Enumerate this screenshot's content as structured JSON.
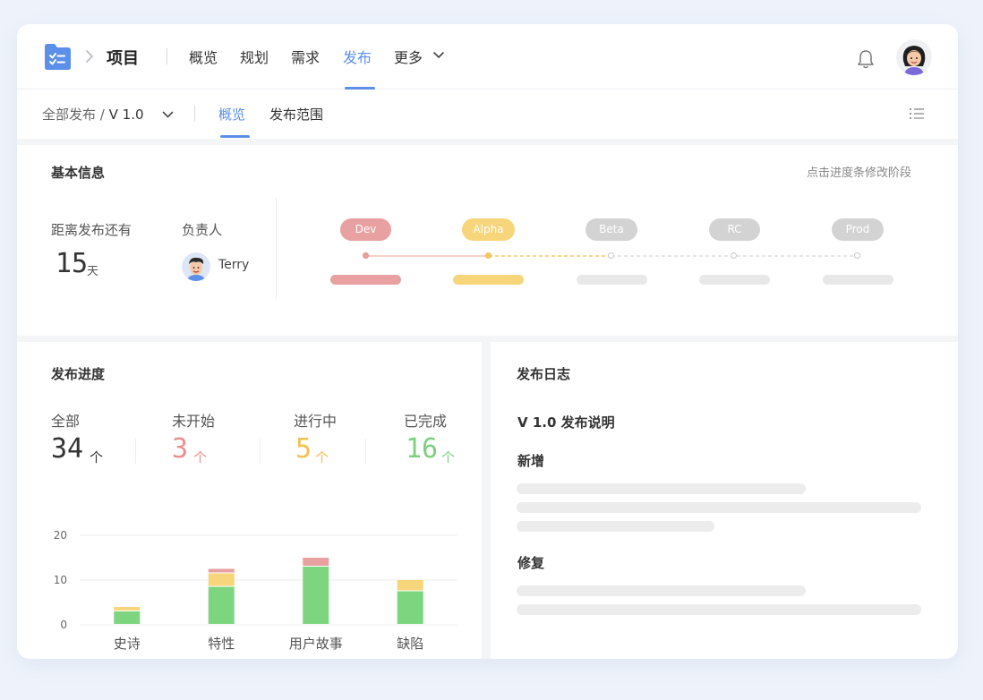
{
  "header": {
    "project_title": "项目",
    "tabs": [
      {
        "label": "概览"
      },
      {
        "label": "规划"
      },
      {
        "label": "需求"
      },
      {
        "label": "发布"
      },
      {
        "label": "更多"
      }
    ]
  },
  "subbar": {
    "crumb_all": "全部发布",
    "crumb_sep": "/",
    "version": "V 1.0",
    "tabs": [
      {
        "label": "概览"
      },
      {
        "label": "发布范围"
      }
    ]
  },
  "basic": {
    "title": "基本信息",
    "hint": "点击进度条修改阶段",
    "countdown_label": "距离发布还有",
    "countdown_value": "15",
    "countdown_unit": "天",
    "owner_label": "负责人",
    "owner_name": "Terry",
    "stages": [
      {
        "name": "Dev",
        "color": "#e8a0a0",
        "state": "done"
      },
      {
        "name": "Alpha",
        "color": "#f7d57a",
        "state": "current"
      },
      {
        "name": "Beta",
        "color": "#d3d3d3",
        "state": "todo"
      },
      {
        "name": "RC",
        "color": "#d3d3d3",
        "state": "todo"
      },
      {
        "name": "Prod",
        "color": "#d3d3d3",
        "state": "todo"
      }
    ]
  },
  "progress": {
    "title": "发布进度",
    "stats": [
      {
        "label": "全部",
        "value": "34",
        "unit": "个",
        "color": "#333333"
      },
      {
        "label": "未开始",
        "value": "3",
        "unit": "个",
        "color": "#e88f8f"
      },
      {
        "label": "进行中",
        "value": "5",
        "unit": "个",
        "color": "#f2c14e"
      },
      {
        "label": "已完成",
        "value": "16",
        "unit": "个",
        "color": "#7dd07f"
      }
    ]
  },
  "chart_data": {
    "type": "bar",
    "stacked": true,
    "categories": [
      "史诗",
      "特性",
      "用户故事",
      "缺陷"
    ],
    "series": [
      {
        "values": [
          3,
          8.5,
          13,
          7.5
        ],
        "color": "#7dd67f"
      },
      {
        "values": [
          1,
          3,
          0,
          2.5
        ],
        "color": "#f7d57a"
      },
      {
        "values": [
          0,
          1,
          2,
          0
        ],
        "color": "#e8a0a0"
      }
    ],
    "yticks": [
      "0",
      "10",
      "20"
    ],
    "ylim": [
      0,
      20
    ],
    "grid": true
  },
  "log": {
    "title": "发布日志",
    "subtitle": "V 1.0 发布说明",
    "section_new": "新增",
    "section_fix": "修复"
  },
  "colors": {
    "accent": "#5b8fe8"
  }
}
